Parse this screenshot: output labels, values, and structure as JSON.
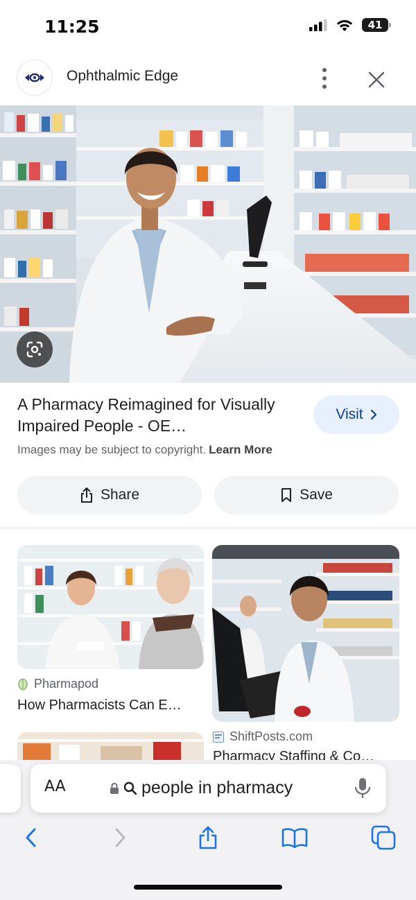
{
  "status_bar": {
    "time": "11:25",
    "battery": "41"
  },
  "header": {
    "site_name": "Ophthalmic Edge",
    "logo_icon": "eye-logo-icon"
  },
  "result": {
    "title": "A Pharmacy Reimagined for Visually Impaired People - OE…",
    "visit_label": "Visit",
    "copyright_text": "Images may be subject to copyright.",
    "learn_more_label": "Learn More",
    "share_label": "Share",
    "save_label": "Save"
  },
  "related": [
    {
      "source": "Pharmapod",
      "title": "How Pharmacists Can E…"
    },
    {
      "source": "ShiftPosts.com",
      "title": "Pharmacy Staffing & Co…"
    }
  ],
  "address_bar": {
    "aa_label": "AA",
    "query": "people in pharmacy"
  },
  "colors": {
    "accent": "#1a73e8",
    "visit_bg": "#e8f0fe",
    "chip_bg": "#f1f3f4",
    "toolbar_bg": "#f2f2f4"
  }
}
